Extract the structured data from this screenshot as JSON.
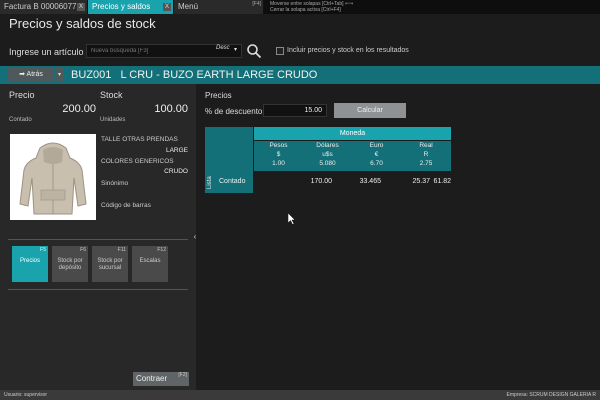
{
  "tabs": [
    {
      "label": "Factura B 00006077",
      "close": "X"
    },
    {
      "label": "Precios y saldos",
      "close": "X"
    },
    {
      "label": "Menú",
      "key": "[F4]"
    }
  ],
  "tab_hints": [
    "Moverse entre solapas [Ctrl+Tab] ⇐⇒",
    "Cerrar la solapa activa [Ctrl+F4]"
  ],
  "page_title": "Precios y saldos de stock",
  "search": {
    "label": "Ingrese un artículo",
    "placeholder": "Nueva búsqueda [F3]",
    "order": "Desc",
    "include_label": "Incluir precios y stock en los resultados"
  },
  "article": {
    "back_label": "➡ Atrás",
    "code": "BUZ001",
    "title": "L  CRU - BUZO EARTH LARGE CRUDO"
  },
  "left": {
    "price_label": "Precio",
    "price_value": "200.00",
    "price_sub": "Contado",
    "stock_label": "Stock",
    "stock_value": "100.00",
    "stock_sub": "Unidades",
    "attr1_label": "TALLE OTRAS PRENDAS",
    "attr1_value": "LARGE",
    "attr2_label": "COLORES GENERICOS",
    "attr2_value": "CRUDO",
    "synonym_label": "Sinónimo",
    "barcode_label": "Código de barras",
    "buttons": [
      {
        "key": "F5",
        "label": "Precios"
      },
      {
        "key": "F6",
        "label": "Stock por depósito"
      },
      {
        "key": "F11",
        "label": "Stock por sucursal"
      },
      {
        "key": "F12",
        "label": "Escalas"
      }
    ],
    "collapse_label": "Contraer",
    "collapse_key": "[F2]"
  },
  "right": {
    "prices_label": "Precios",
    "discount_label": "% de descuento",
    "discount_value": "15.00",
    "calc_label": "Calcular",
    "table": {
      "list_header": "Lista",
      "currency_header": "Moneda",
      "columns": [
        {
          "name": "Pesos",
          "symbol": "$",
          "rate": "1.00"
        },
        {
          "name": "Dólares",
          "symbol": "u$s",
          "rate": "5.080"
        },
        {
          "name": "Euro",
          "symbol": "€",
          "rate": "6.70"
        },
        {
          "name": "Real",
          "symbol": "R",
          "rate": "2.75"
        }
      ],
      "row_label": "Contado",
      "row_values": [
        "170.00",
        "33.465",
        "25.37",
        "61.82"
      ]
    }
  },
  "status": {
    "user": "Usuario: supervisor",
    "company": "Empresa: SCRUM DESIGN GALERIA R"
  }
}
